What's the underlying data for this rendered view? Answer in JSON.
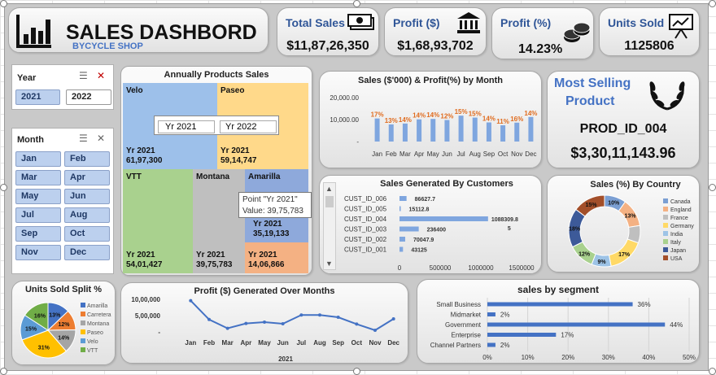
{
  "header": {
    "title": "SALES DASHBORD",
    "subtitle": "BYCYCLE SHOP"
  },
  "kpis": [
    {
      "label": "Total Sales",
      "value": "$11,87,26,350",
      "icon": "cash-icon"
    },
    {
      "label": "Profit ($)",
      "value": "$1,68,93,702",
      "icon": "bank-icon"
    },
    {
      "label": "Profit (%)",
      "value": "14.23%",
      "icon": "coins-icon"
    },
    {
      "label": "Units Sold",
      "value": "1125806",
      "icon": "presentation-icon"
    }
  ],
  "year_slicer": {
    "title": "Year",
    "items": [
      {
        "label": "2021",
        "selected": true
      },
      {
        "label": "2022",
        "selected": false
      }
    ]
  },
  "month_slicer": {
    "title": "Month",
    "items": [
      "Jan",
      "Feb",
      "Mar",
      "Apr",
      "May",
      "Jun",
      "Jul",
      "Aug",
      "Sep",
      "Oct",
      "Nov",
      "Dec"
    ]
  },
  "treemap": {
    "title": "Annually Products Sales",
    "legend": [
      "Yr 2021",
      "Yr 2022"
    ],
    "tooltip": {
      "line1": "Point \"Yr 2021\"",
      "line2": "Value: 39,75,783"
    },
    "cells": [
      {
        "product": "Velo",
        "label": "Yr 2021",
        "value": "61,97,300"
      },
      {
        "product": "Paseo",
        "label": "Yr 2021",
        "value": "59,14,747"
      },
      {
        "product": "VTT",
        "label": "Yr 2021",
        "value": "54,01,427"
      },
      {
        "product": "Montana",
        "label": "Yr 2021",
        "value": "39,75,783"
      },
      {
        "product": "Amarilla",
        "label": "Yr 2021",
        "value": "35,19,133"
      },
      {
        "product": "",
        "label": "Yr 2021",
        "value": "14,06,866"
      }
    ]
  },
  "most_selling": {
    "title_line1": "Most Selling",
    "title_line2": "Product",
    "product": "PROD_ID_004",
    "value": "$3,30,11,143.96"
  },
  "chart_data": [
    {
      "id": "sales-profit-month",
      "type": "bar",
      "title": "Sales ($'000) & Profit(%) by Month",
      "categories": [
        "Jan",
        "Feb",
        "Mar",
        "Apr",
        "May",
        "Jun",
        "Jul",
        "Aug",
        "Sep",
        "Oct",
        "Nov",
        "Dec"
      ],
      "series": [
        {
          "values": [
            10500,
            7800,
            8200,
            10100,
            10300,
            9800,
            11800,
            10900,
            8700,
            7400,
            8600,
            11200
          ]
        },
        {
          "values": [
            "17%",
            "13%",
            "14%",
            "14%",
            "14%",
            "12%",
            "15%",
            "15%",
            "14%",
            "11%",
            "16%",
            "14%"
          ]
        }
      ],
      "yticks": [
        "20,000.00",
        "10,000.00",
        "-"
      ],
      "ylim": [
        0,
        20000
      ],
      "colors": {
        "bar": "#7fa6df",
        "label": "#e06c1f"
      }
    },
    {
      "id": "sales-by-customer",
      "type": "bar",
      "title": "Sales Generated By Customers",
      "categories": [
        "CUST_ID_006",
        "CUST_ID_005",
        "CUST_ID_004",
        "CUST_ID_003",
        "CUST_ID_002",
        "CUST_ID_001"
      ],
      "values": [
        86627.7,
        15112.8,
        1088309.85,
        236400,
        70047.9,
        43125
      ],
      "value_labels": [
        "86627.7",
        "15112.8",
        "1088309.8",
        "236400",
        "70047.9",
        "43125"
      ],
      "value_label_extra": "5",
      "xticks": [
        "0",
        "500000",
        "1000000",
        "1500000"
      ],
      "xlim": [
        0,
        1500000
      ],
      "colors": {
        "bar": "#7fa6df"
      }
    },
    {
      "id": "sales-by-country",
      "type": "pie",
      "title": "Sales (%) By Country",
      "categories": [
        "Canada",
        "England",
        "France",
        "Germany",
        "India",
        "Italy",
        "Japan",
        "USA"
      ],
      "values": [
        10,
        13,
        8,
        17,
        9,
        12,
        18,
        15
      ],
      "labels": [
        "10%",
        "13%",
        "",
        "17%",
        "9%",
        "12%",
        "18%",
        "15%"
      ],
      "colors": [
        "#7b9fd3",
        "#f4b183",
        "#bfbfbf",
        "#ffd966",
        "#9dc3e6",
        "#a9d18e",
        "#3d5a99",
        "#a34f2a"
      ]
    },
    {
      "id": "units-sold-split",
      "type": "pie",
      "title": "Units Sold Split %",
      "categories": [
        "Amarilla",
        "Carretera",
        "Montana",
        "Paseo",
        "Velo",
        "VTT"
      ],
      "values": [
        13,
        12,
        14,
        31,
        15,
        16
      ],
      "labels": [
        "13%",
        "12%",
        "14%",
        "31%",
        "15%",
        "16%"
      ],
      "colors": [
        "#4472c4",
        "#ed7d31",
        "#a5a5a5",
        "#ffc000",
        "#5b9bd5",
        "#70ad47"
      ]
    },
    {
      "id": "profit-over-months",
      "type": "line",
      "title": "Profit ($) Generated Over Months",
      "categories": [
        "Jan",
        "Feb",
        "Mar",
        "Apr",
        "May",
        "Jun",
        "Jul",
        "Aug",
        "Sep",
        "Oct",
        "Nov",
        "Dec"
      ],
      "values": [
        960000,
        380000,
        110000,
        260000,
        300000,
        250000,
        520000,
        520000,
        450000,
        240000,
        50000,
        400000
      ],
      "yticks": [
        "10,00,000",
        "5,00,000",
        "-"
      ],
      "ylim": [
        0,
        1000000
      ],
      "xlabel": "2021",
      "colors": {
        "line": "#4472c4"
      }
    },
    {
      "id": "sales-by-segment",
      "type": "bar",
      "title": "sales by segment",
      "categories": [
        "Small Business",
        "Midmarket",
        "Government",
        "Enterprise",
        "Channel Partners"
      ],
      "values": [
        36,
        2,
        44,
        17,
        2
      ],
      "value_labels": [
        "36%",
        "2%",
        "44%",
        "17%",
        "2%"
      ],
      "xticks": [
        "0%",
        "10%",
        "20%",
        "30%",
        "40%",
        "50%"
      ],
      "xlim": [
        0,
        50
      ],
      "colors": {
        "bar": "#4472c4"
      }
    }
  ]
}
